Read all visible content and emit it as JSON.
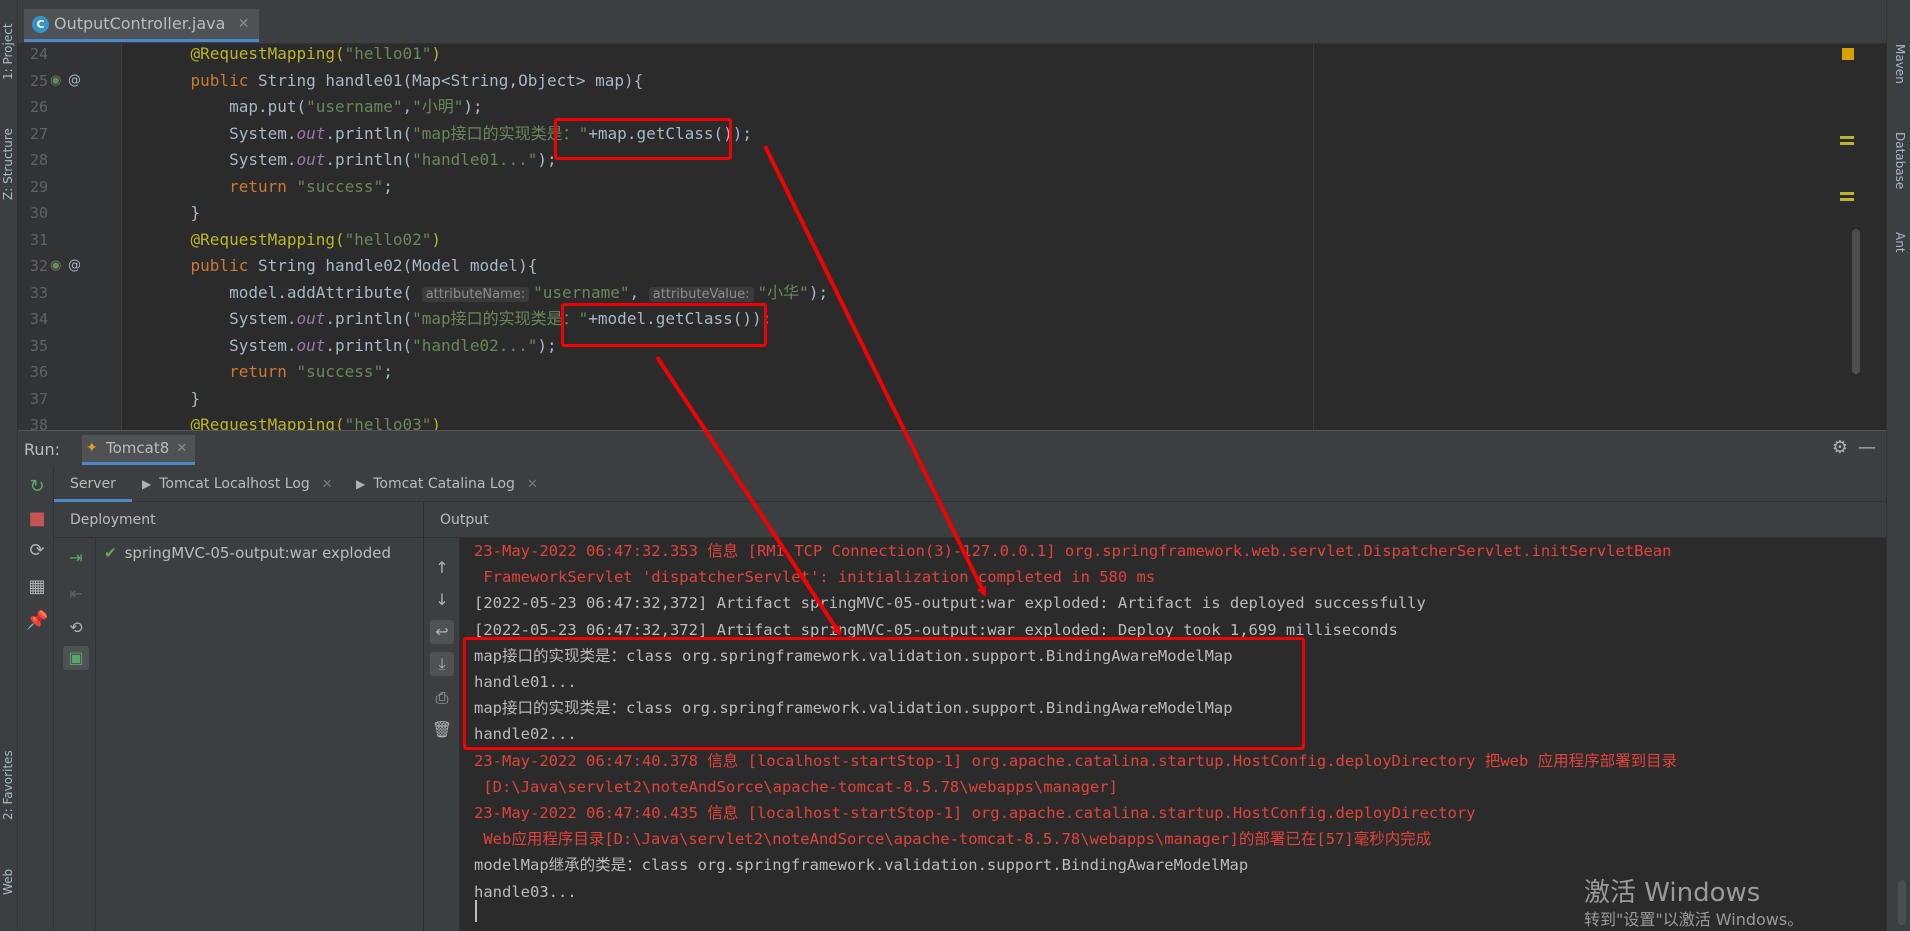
{
  "editor": {
    "tab_label": "OutputController.java",
    "tab_icon": "C",
    "lines": [
      {
        "num": "24",
        "segs": [
          [
            "ann",
            "    @RequestMapping("
          ],
          [
            "str",
            "\"hello01\""
          ],
          [
            "ann",
            ")"
          ]
        ]
      },
      {
        "num": "25",
        "icons": [
          "leaf",
          "at"
        ],
        "segs": [
          [
            "kw",
            "    public "
          ],
          [
            "",
            "String "
          ],
          [
            "",
            "handle01(Map<String,Object> map){"
          ]
        ]
      },
      {
        "num": "26",
        "segs": [
          [
            "",
            "        map.put("
          ],
          [
            "str",
            "\"username\""
          ],
          [
            "",
            ","
          ],
          [
            "str",
            "\"小明\""
          ],
          [
            "",
            ");"
          ]
        ]
      },
      {
        "num": "27",
        "segs": [
          [
            "",
            "        System."
          ],
          [
            "fld",
            "out"
          ],
          [
            "",
            ".println("
          ],
          [
            "str",
            "\"map接口的实现类是：\""
          ],
          [
            "",
            "+map.getClass());"
          ]
        ]
      },
      {
        "num": "28",
        "segs": [
          [
            "",
            "        System."
          ],
          [
            "fld",
            "out"
          ],
          [
            "",
            ".println("
          ],
          [
            "str",
            "\"handle01...\""
          ],
          [
            "",
            ");"
          ]
        ]
      },
      {
        "num": "29",
        "segs": [
          [
            "kw",
            "        return "
          ],
          [
            "str",
            "\"success\""
          ],
          [
            "",
            ";"
          ]
        ]
      },
      {
        "num": "30",
        "segs": [
          [
            "",
            "    }"
          ]
        ]
      },
      {
        "num": "31",
        "segs": [
          [
            "ann",
            "    @RequestMapping("
          ],
          [
            "str",
            "\"hello02\""
          ],
          [
            "ann",
            ")"
          ]
        ]
      },
      {
        "num": "32",
        "icons": [
          "leaf",
          "at"
        ],
        "segs": [
          [
            "kw",
            "    public "
          ],
          [
            "",
            "String "
          ],
          [
            "",
            "handle02(Model model){"
          ]
        ]
      },
      {
        "num": "33",
        "segs": [
          [
            "",
            "        model.addAttribute( "
          ],
          [
            "hint",
            "attributeName:"
          ],
          [
            "str",
            "\"username\""
          ],
          [
            "",
            ", "
          ],
          [
            "hint",
            "attributeValue:"
          ],
          [
            "str",
            "\"小华\""
          ],
          [
            "",
            ");"
          ]
        ]
      },
      {
        "num": "34",
        "segs": [
          [
            "",
            "        System."
          ],
          [
            "fld",
            "out"
          ],
          [
            "",
            ".println("
          ],
          [
            "str",
            "\"map接口的实现类是：\""
          ],
          [
            "",
            "+model.getClass());"
          ]
        ]
      },
      {
        "num": "35",
        "segs": [
          [
            "",
            "        System."
          ],
          [
            "fld",
            "out"
          ],
          [
            "",
            ".println("
          ],
          [
            "str",
            "\"handle02...\""
          ],
          [
            "",
            ");"
          ]
        ]
      },
      {
        "num": "36",
        "segs": [
          [
            "kw",
            "        return "
          ],
          [
            "str",
            "\"success\""
          ],
          [
            "",
            ";"
          ]
        ]
      },
      {
        "num": "37",
        "segs": [
          [
            "",
            "    }"
          ]
        ]
      },
      {
        "num": "38",
        "segs": [
          [
            "ann",
            "    @RequestMapping("
          ],
          [
            "str",
            "\"hello03\""
          ],
          [
            "ann",
            ")"
          ]
        ]
      }
    ]
  },
  "left_strip": {
    "project": "1: Project",
    "structure": "Z: Structure",
    "favorites": "2: Favorites",
    "web": "Web"
  },
  "right_strip": {
    "maven": "Maven",
    "database": "Database",
    "ant": "Ant"
  },
  "run": {
    "label": "Run:",
    "config_tab": "Tomcat8",
    "sub_tabs": [
      "Server",
      "Tomcat Localhost Log",
      "Tomcat Catalina Log"
    ],
    "deployment_header": "Deployment",
    "output_header": "Output",
    "artifact": "springMVC-05-output:war exploded"
  },
  "console": {
    "lines": [
      {
        "type": "err",
        "text": "23-May-2022 06:47:32.353 信息 [RMI TCP Connection(3)-127.0.0.1] org.springframework.web.servlet.DispatcherServlet.initServletBean"
      },
      {
        "type": "err",
        "text": " FrameworkServlet 'dispatcherServlet': initialization completed in 580 ms"
      },
      {
        "type": "out",
        "text": "[2022-05-23 06:47:32,372] Artifact springMVC-05-output:war exploded: Artifact is deployed successfully"
      },
      {
        "type": "out",
        "text": "[2022-05-23 06:47:32,372] Artifact springMVC-05-output:war exploded: Deploy took 1,699 milliseconds"
      },
      {
        "type": "out",
        "text": "map接口的实现类是：class org.springframework.validation.support.BindingAwareModelMap"
      },
      {
        "type": "out",
        "text": "handle01..."
      },
      {
        "type": "out",
        "text": "map接口的实现类是：class org.springframework.validation.support.BindingAwareModelMap"
      },
      {
        "type": "out",
        "text": "handle02..."
      },
      {
        "type": "err",
        "text": "23-May-2022 06:47:40.378 信息 [localhost-startStop-1] org.apache.catalina.startup.HostConfig.deployDirectory 把web 应用程序部署到目录"
      },
      {
        "type": "err",
        "text": " [D:\\Java\\servlet2\\noteAndSorce\\apache-tomcat-8.5.78\\webapps\\manager]"
      },
      {
        "type": "err",
        "text": "23-May-2022 06:47:40.435 信息 [localhost-startStop-1] org.apache.catalina.startup.HostConfig.deployDirectory"
      },
      {
        "type": "err",
        "text": " Web应用程序目录[D:\\Java\\servlet2\\noteAndSorce\\apache-tomcat-8.5.78\\webapps\\manager]的部署已在[57]毫秒内完成"
      },
      {
        "type": "out",
        "text": "modelMap继承的类是：class org.springframework.validation.support.BindingAwareModelMap"
      },
      {
        "type": "out",
        "text": "handle03..."
      }
    ]
  },
  "watermark": {
    "line1": "激活 Windows",
    "line2": "转到\"设置\"以激活 Windows。"
  },
  "colors": {
    "annotation_red": "#f00000",
    "accent_blue": "#4a88c7",
    "error_text": "#e0433b"
  }
}
